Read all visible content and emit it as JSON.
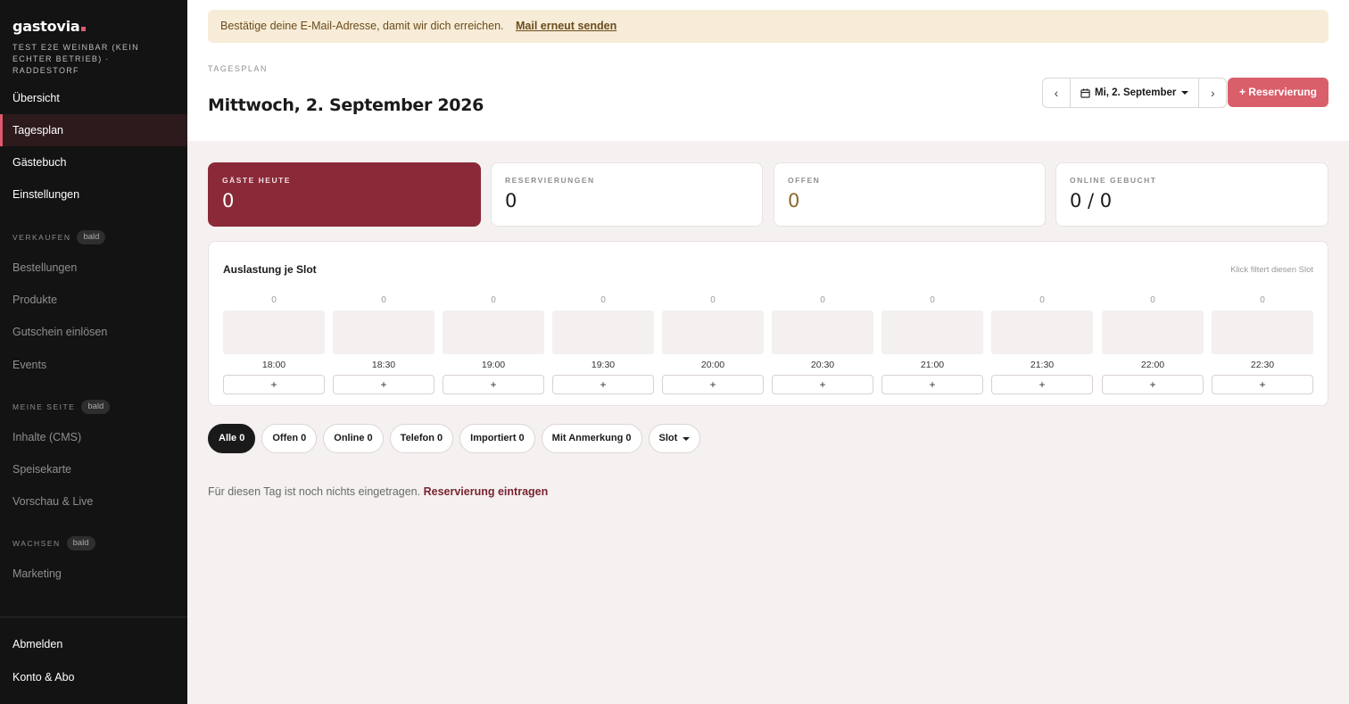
{
  "sidebar": {
    "brand": "gastovia",
    "venue": "TEST E2E WEINBAR (KEIN ECHTER BETRIEB) · RADDESTORF",
    "main_items": [
      "Übersicht",
      "Tagesplan",
      "Gästebuch",
      "Einstellungen"
    ],
    "active_item": "Tagesplan",
    "sections": [
      {
        "title": "VERKAUFEN",
        "badge": "bald",
        "items": [
          "Bestellungen",
          "Produkte",
          "Gutschein einlösen",
          "Events"
        ]
      },
      {
        "title": "MEINE SEITE",
        "badge": "bald",
        "items": [
          "Inhalte (CMS)",
          "Speisekarte",
          "Vorschau & Live"
        ]
      },
      {
        "title": "WACHSEN",
        "badge": "bald",
        "items": [
          "Marketing"
        ]
      }
    ],
    "footer_items": [
      "Abmelden",
      "Konto & Abo"
    ]
  },
  "banner": {
    "text": "Bestätige deine E-Mail-Adresse, damit wir dich erreichen.",
    "link": "Mail erneut senden"
  },
  "header": {
    "breadcrumb": "TAGESPLAN",
    "title": "Mittwoch, 2. September 2026",
    "prev": "‹",
    "next": "›",
    "date_label": "Mi, 2. September",
    "add_button": "+ Reservierung"
  },
  "stats": [
    {
      "label": "GÄSTE HEUTE",
      "value": "0"
    },
    {
      "label": "RESERVIERUNGEN",
      "value": "0"
    },
    {
      "label": "OFFEN",
      "value": "0"
    },
    {
      "label": "ONLINE GEBUCHT",
      "value": "0 / 0"
    }
  ],
  "slots": {
    "title": "Auslastung je Slot",
    "hint": "Klick filtert diesen Slot",
    "add_label": "+",
    "items": [
      {
        "time": "18:00",
        "count": "0"
      },
      {
        "time": "18:30",
        "count": "0"
      },
      {
        "time": "19:00",
        "count": "0"
      },
      {
        "time": "19:30",
        "count": "0"
      },
      {
        "time": "20:00",
        "count": "0"
      },
      {
        "time": "20:30",
        "count": "0"
      },
      {
        "time": "21:00",
        "count": "0"
      },
      {
        "time": "21:30",
        "count": "0"
      },
      {
        "time": "22:00",
        "count": "0"
      },
      {
        "time": "22:30",
        "count": "0"
      }
    ]
  },
  "filters": {
    "chips": [
      "Alle 0",
      "Offen 0",
      "Online 0",
      "Telefon 0",
      "Importiert 0",
      "Mit Anmerkung 0"
    ],
    "active": "Alle 0",
    "slot_dropdown": "Slot"
  },
  "empty_state": {
    "text": "Für diesen Tag ist noch nichts eingetragen.",
    "link": "Reservierung eintragen"
  },
  "colors": {
    "accent": "#d95f6b",
    "primary_card": "#8a2a38",
    "sidebar_bg": "#131313",
    "banner_bg": "#f7ecd7"
  }
}
